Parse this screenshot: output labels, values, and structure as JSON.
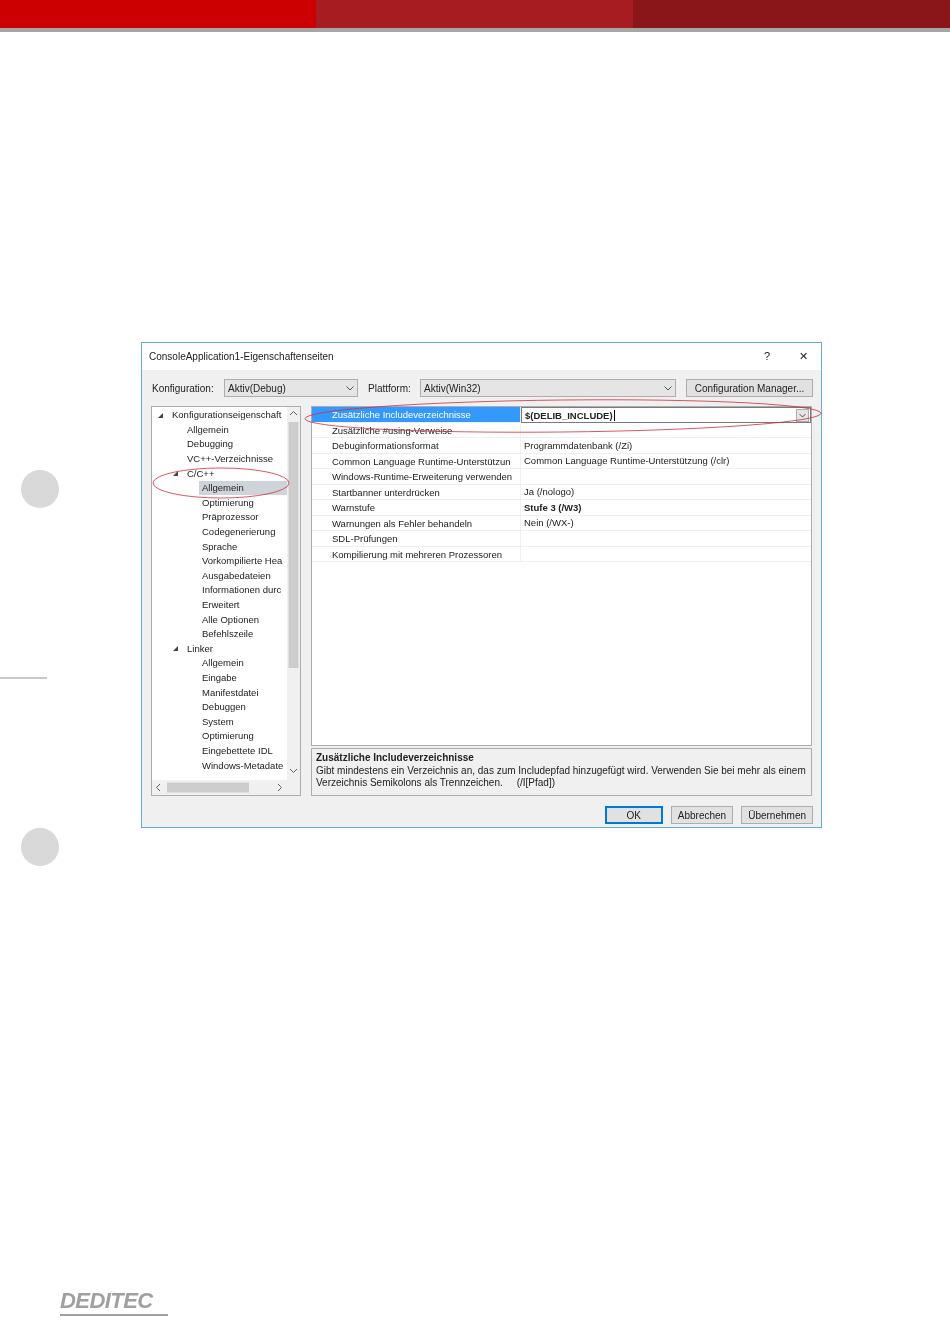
{
  "dialog": {
    "title": "ConsoleApplication1-Eigenschaftenseiten",
    "help": "?",
    "close": "✕",
    "configuration": {
      "label": "Konfiguration:",
      "value": "Aktiv(Debug)"
    },
    "platform": {
      "label": "Plattform:",
      "value": "Aktiv(Win32)"
    },
    "manager_button": "Configuration Manager...",
    "tree": [
      {
        "label": "Konfigurationseigenschaft",
        "expanded": true,
        "selected": false,
        "children": [
          {
            "label": "Allgemein",
            "selected": false
          },
          {
            "label": "Debugging",
            "selected": false
          },
          {
            "label": "VC++-Verzeichnisse",
            "selected": false
          },
          {
            "label": "C/C++",
            "expanded": true,
            "selected": false,
            "children": [
              {
                "label": "Allgemein",
                "selected": true
              },
              {
                "label": "Optimierung",
                "selected": false
              },
              {
                "label": "Präprozessor",
                "selected": false
              },
              {
                "label": "Codegenerierung",
                "selected": false
              },
              {
                "label": "Sprache",
                "selected": false
              },
              {
                "label": "Vorkompilierte Hea",
                "selected": false
              },
              {
                "label": "Ausgabedateien",
                "selected": false
              },
              {
                "label": "Informationen durc",
                "selected": false
              },
              {
                "label": "Erweitert",
                "selected": false
              },
              {
                "label": "Alle Optionen",
                "selected": false
              },
              {
                "label": "Befehlszeile",
                "selected": false
              }
            ]
          },
          {
            "label": "Linker",
            "expanded": true,
            "selected": false,
            "children": [
              {
                "label": "Allgemein",
                "selected": false
              },
              {
                "label": "Eingabe",
                "selected": false
              },
              {
                "label": "Manifestdatei",
                "selected": false
              },
              {
                "label": "Debuggen",
                "selected": false
              },
              {
                "label": "System",
                "selected": false
              },
              {
                "label": "Optimierung",
                "selected": false
              },
              {
                "label": "Eingebettete IDL",
                "selected": false
              },
              {
                "label": "Windows-Metadate",
                "selected": false
              }
            ]
          }
        ]
      }
    ],
    "properties": [
      {
        "name": "Zusätzliche Includeverzeichnisse",
        "value": "$(DELIB_INCLUDE)",
        "selected": true,
        "bold": true
      },
      {
        "name": "Zusätzliche #using-Verweise",
        "selected": false
      },
      {
        "name": "Debuginformationsformat",
        "value": "Programmdatenbank (/Zi)",
        "selected": false,
        "bold": false
      },
      {
        "name": "Common Language Runtime-Unterstützun",
        "value": "Common Language Runtime-Unterstützung (/clr)",
        "selected": false,
        "bold": false
      },
      {
        "name": "Windows-Runtime-Erweiterung verwenden",
        "selected": false
      },
      {
        "name": "Startbanner unterdrücken",
        "value": "Ja (/nologo)",
        "selected": false,
        "bold": false
      },
      {
        "name": "Warnstufe",
        "value": "Stufe 3 (/W3)",
        "selected": false,
        "bold": true
      },
      {
        "name": "Warnungen als Fehler behandeln",
        "value": "Nein (/WX-)",
        "selected": false,
        "bold": false
      },
      {
        "name": "SDL-Prüfungen",
        "selected": false
      },
      {
        "name": "Kompilierung mit mehreren Prozessoren",
        "selected": false
      }
    ],
    "description": {
      "title": "Zusätzliche Includeverzeichnisse",
      "text": "Gibt mindestens ein Verzeichnis an, das zum Includepfad hinzugefügt wird. Verwenden Sie bei mehr als einem Verzeichnis Semikolons als Trennzeichen.     (/I[Pfad])"
    },
    "buttons": [
      {
        "label": "OK",
        "default": true
      },
      {
        "label": "Abbrechen",
        "default": false
      },
      {
        "label": "Übernehmen",
        "default": false
      }
    ]
  },
  "footer": {
    "logo": "DEDITEC"
  }
}
